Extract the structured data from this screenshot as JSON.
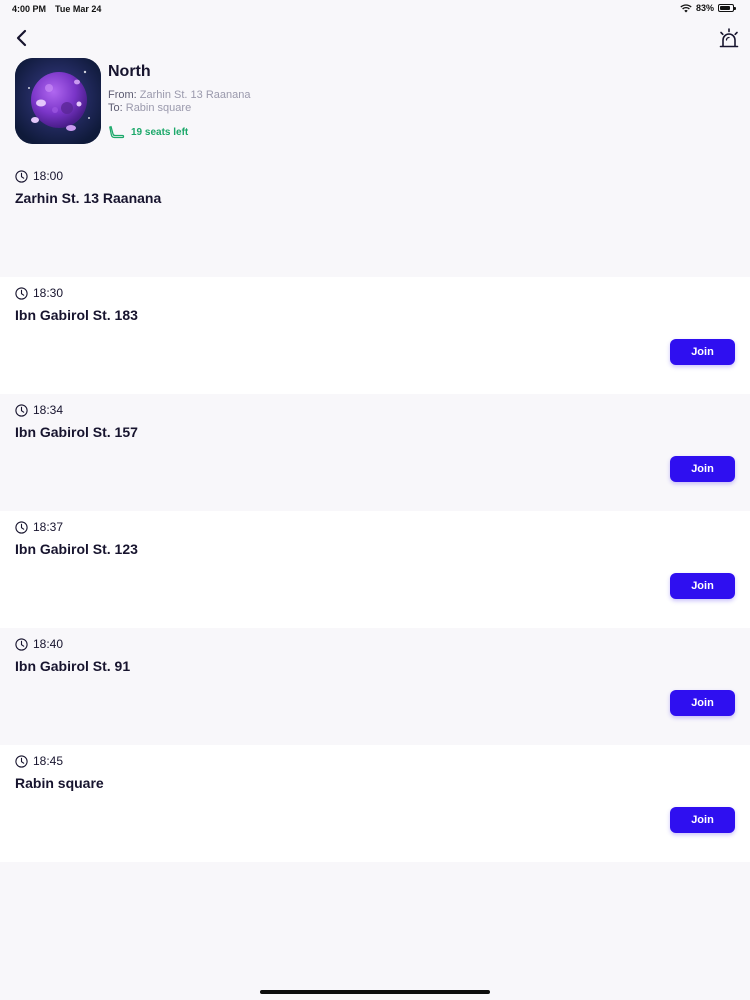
{
  "status_bar": {
    "time": "4:00 PM",
    "date": "Tue Mar 24",
    "battery_pct": "83%",
    "battery_level": 0.83
  },
  "header": {
    "title": "North",
    "from_label": "From:",
    "from_value": "Zarhin St. 13 Raanana",
    "to_label": "To:",
    "to_value": "Rabin square",
    "seats": "19 seats left"
  },
  "colors": {
    "accent": "#2f0ff0",
    "seats_green": "#1ca86a",
    "text_dark": "#17142e"
  },
  "icons": {
    "back": "chevron-left-icon",
    "alarm": "siren-icon",
    "clock": "clock-icon",
    "seat": "seat-icon"
  },
  "stops": [
    {
      "time": "18:00",
      "name": "Zarhin St. 13 Raanana"
    },
    {
      "time": "18:30",
      "name": "Ibn Gabirol St. 183",
      "join_label": "Join"
    },
    {
      "time": "18:34",
      "name": "Ibn Gabirol St. 157",
      "join_label": "Join"
    },
    {
      "time": "18:37",
      "name": "Ibn Gabirol St. 123",
      "join_label": "Join"
    },
    {
      "time": "18:40",
      "name": "Ibn Gabirol St. 91",
      "join_label": "Join"
    },
    {
      "time": "18:45",
      "name": "Rabin square",
      "join_label": "Join"
    }
  ]
}
